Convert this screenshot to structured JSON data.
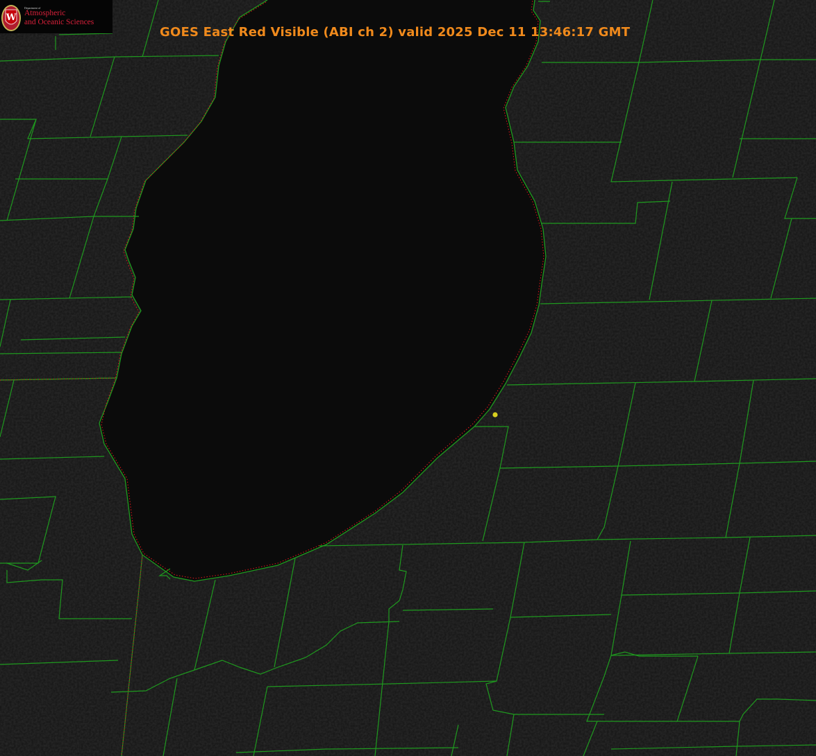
{
  "title": "GOES East Red Visible (ABI ch 2) valid 2025 Dec 11 13:46:17 GMT",
  "logo": {
    "department": "Department of",
    "line1": "Atmospheric",
    "line2": "and Oceanic Sciences",
    "seal_letter": "W"
  },
  "colors": {
    "land": "#141414",
    "lake": "#0a0a0a",
    "county_lines": "#1f9a1f",
    "shoreline_dotted": "#d01818",
    "title": "#f08a1c",
    "logo_text": "#d8203a",
    "station_marker": "#d8d020"
  },
  "map": {
    "imagery": "satellite visible (night/low light)",
    "features": [
      "lake",
      "county-boundaries",
      "state-boundary",
      "shoreline",
      "station-marker"
    ]
  }
}
